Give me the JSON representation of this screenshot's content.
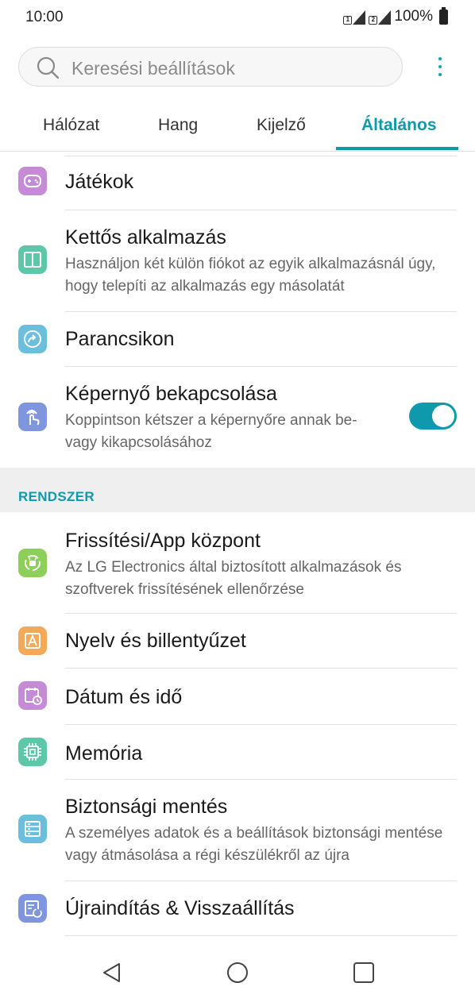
{
  "status": {
    "time": "10:00",
    "battery": "100%",
    "sim1": "1",
    "sim2": "2"
  },
  "search": {
    "placeholder": "Keresési beállítások"
  },
  "tabs": [
    {
      "label": "Hálózat"
    },
    {
      "label": "Hang"
    },
    {
      "label": "Kijelző"
    },
    {
      "label": "Általános",
      "active": true
    }
  ],
  "items": {
    "games": {
      "title": "Játékok",
      "icon": "gamepad-icon"
    },
    "dual_app": {
      "title": "Kettős alkalmazás",
      "desc": "Használjon két külön fiókot az egyik alkalmazásnál úgy, hogy telepíti az alkalmazás egy másolatát",
      "icon": "dual-app-icon"
    },
    "shortcuts": {
      "title": "Parancsikon",
      "icon": "shortcut-icon"
    },
    "screen_on": {
      "title": "Képernyő bekapcsolása",
      "desc": "Koppintson kétszer a képernyőre annak be-vagy kikapcsolásához",
      "icon": "knock-icon",
      "toggle_on": true
    },
    "update": {
      "title": "Frissítési/App központ",
      "desc": "Az LG Electronics által biztosított alkalmazások és szoftverek frissítésének ellenőrzése",
      "icon": "update-center-icon"
    },
    "language": {
      "title": "Nyelv és billentyűzet",
      "icon": "language-icon"
    },
    "datetime": {
      "title": "Dátum és idő",
      "icon": "calendar-clock-icon"
    },
    "memory": {
      "title": "Memória",
      "icon": "chip-icon"
    },
    "backup": {
      "title": "Biztonsági mentés",
      "desc": "A személyes adatok és a beállítások biztonsági mentése vagy átmásolása a régi készülékről az újra",
      "icon": "backup-icon"
    },
    "reset": {
      "title": "Újraindítás & Visszaállítás",
      "icon": "reset-icon"
    }
  },
  "section_system": "RENDSZER",
  "colors": {
    "accent": "#0e9aac",
    "purple": "#c58bd6",
    "teal": "#5ec6a9",
    "blue": "#6bbfdc",
    "indigo": "#7f95dd",
    "green": "#8cd05a",
    "orange": "#f3a95a"
  }
}
